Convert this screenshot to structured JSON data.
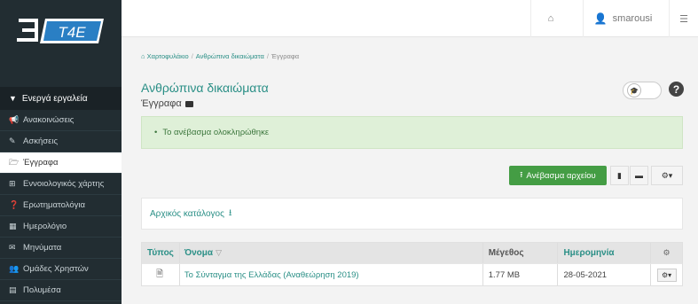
{
  "brand": {
    "logo_text": "T4E",
    "accent": "#2a8f86"
  },
  "topbar": {
    "home_icon": "home-icon",
    "user_name": "smarousi",
    "menu_icon": "sliders-icon"
  },
  "sidebar": {
    "section_label": "Ενεργά εργαλεία",
    "items": [
      {
        "label": "Ανακοινώσεις",
        "icon": "bullhorn-icon",
        "glyph": "📢"
      },
      {
        "label": "Ασκήσεις",
        "icon": "edit-icon",
        "glyph": "✎"
      },
      {
        "label": "Έγγραφα",
        "icon": "folder-open-icon",
        "glyph": "🗁",
        "active": true
      },
      {
        "label": "Εννοιολογικός χάρτης",
        "icon": "sitemap-icon",
        "glyph": "⊞"
      },
      {
        "label": "Ερωτηματολόγια",
        "icon": "question-circle-icon",
        "glyph": "❓"
      },
      {
        "label": "Ημερολόγιο",
        "icon": "calendar-icon",
        "glyph": "▦"
      },
      {
        "label": "Μηνύματα",
        "icon": "envelope-icon",
        "glyph": "✉"
      },
      {
        "label": "Ομάδες Χρηστών",
        "icon": "users-icon",
        "glyph": "👥"
      },
      {
        "label": "Πολυμέσα",
        "icon": "film-icon",
        "glyph": "▤"
      }
    ]
  },
  "breadcrumb": {
    "home": "Χαρτοφυλάκιο",
    "course": "Ανθρώπινα δικαιώματα",
    "current": "Έγγραφα"
  },
  "page": {
    "title": "Ανθρώπινα δικαιώματα",
    "subtitle": "Έγγραφα"
  },
  "alert": {
    "message": "Το ανέβασμα ολοκληρώθηκε"
  },
  "toolbar": {
    "upload_label": "Ανέβασμα αρχείου"
  },
  "root": {
    "label": "Αρχικός κατάλογος"
  },
  "table": {
    "headers": {
      "type": "Τύπος",
      "name": "Όνομα",
      "size": "Μέγεθος",
      "date": "Ημερομηνία"
    },
    "rows": [
      {
        "type_icon": "file-pdf-icon",
        "name": "Το Σύνταγμα της Ελλάδας (Αναθεώρηση 2019)",
        "size": "1.77 MB",
        "date": "28-05-2021"
      }
    ]
  }
}
